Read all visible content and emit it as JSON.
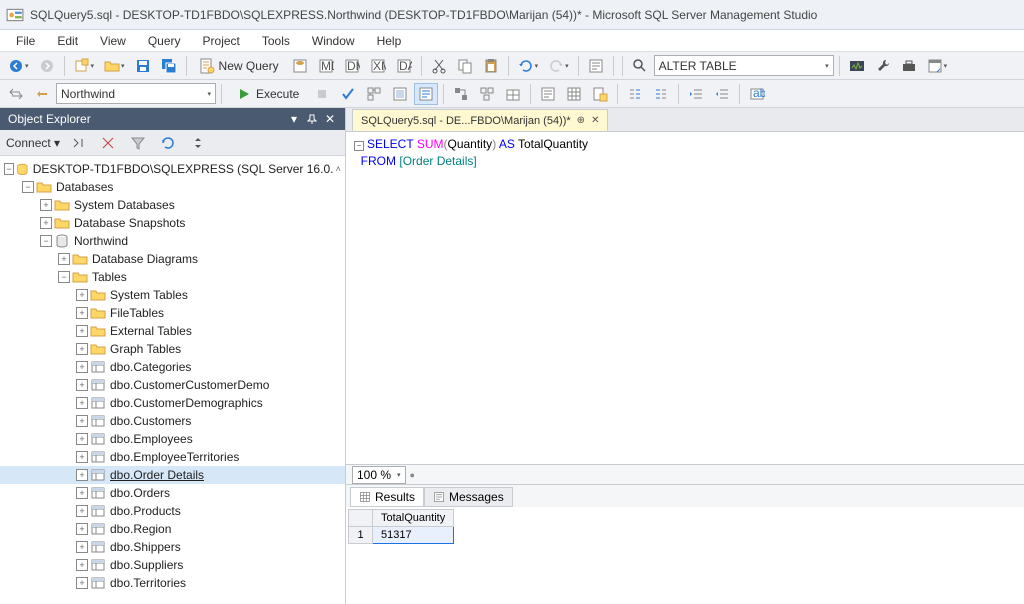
{
  "window": {
    "title": "SQLQuery5.sql - DESKTOP-TD1FBDO\\SQLEXPRESS.Northwind (DESKTOP-TD1FBDO\\Marijan (54))* - Microsoft SQL Server Management Studio"
  },
  "menu": {
    "items": [
      "File",
      "Edit",
      "View",
      "Query",
      "Project",
      "Tools",
      "Window",
      "Help"
    ]
  },
  "toolbar": {
    "new_query": "New Query",
    "alter_combo": "ALTER TABLE",
    "db_combo": "Northwind",
    "execute": "Execute"
  },
  "object_explorer": {
    "title": "Object Explorer",
    "connect": "Connect",
    "server": "DESKTOP-TD1FBDO\\SQLEXPRESS (SQL Server 16.0.",
    "databases": "Databases",
    "sys_db": "System Databases",
    "db_snap": "Database Snapshots",
    "northwind": "Northwind",
    "db_diag": "Database Diagrams",
    "tables": "Tables",
    "sys_tables": "System Tables",
    "file_tables": "FileTables",
    "ext_tables": "External Tables",
    "graph_tables": "Graph Tables",
    "t_categories": "dbo.Categories",
    "t_custcustdemo": "dbo.CustomerCustomerDemo",
    "t_custdemo": "dbo.CustomerDemographics",
    "t_customers": "dbo.Customers",
    "t_employees": "dbo.Employees",
    "t_empterr": "dbo.EmployeeTerritories",
    "t_orderdetails": "dbo.Order Details",
    "t_orders": "dbo.Orders",
    "t_products": "dbo.Products",
    "t_region": "dbo.Region",
    "t_shippers": "dbo.Shippers",
    "t_suppliers": "dbo.Suppliers",
    "t_territories": "dbo.Territories"
  },
  "tab": {
    "label": "SQLQuery5.sql - DE...FBDO\\Marijan (54))*"
  },
  "sql": {
    "select": "SELECT",
    "sum": "SUM",
    "q1": "(",
    "quantity": "Quantity",
    "q2": ")",
    "as": "AS",
    "alias": "TotalQuantity",
    "from": "FROM",
    "br1": "[",
    "table": "Order Details",
    "br2": "]"
  },
  "zoom": "100 %",
  "results": {
    "tab_results": "Results",
    "tab_messages": "Messages",
    "col1": "TotalQuantity",
    "row1num": "1",
    "row1val": "51317"
  }
}
